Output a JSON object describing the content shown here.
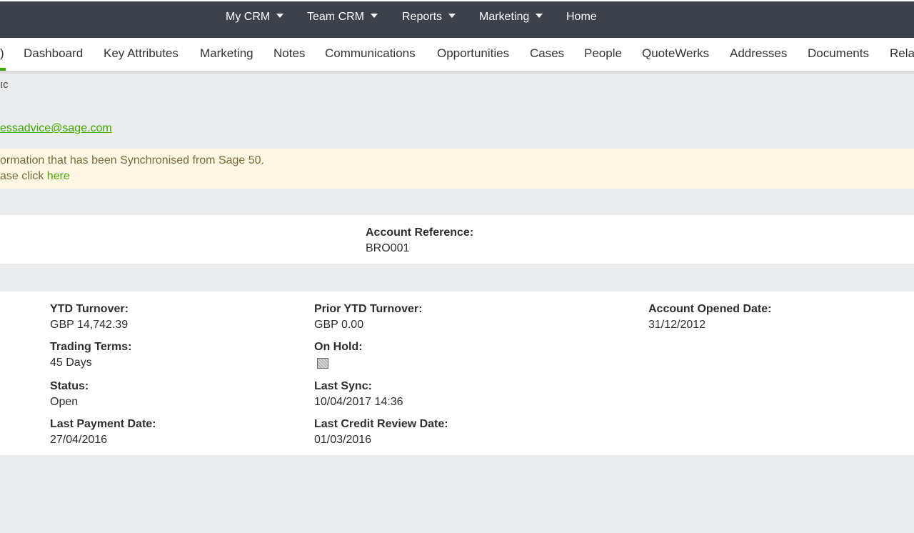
{
  "topnav": {
    "items": [
      {
        "label": "My CRM",
        "dropdown": true
      },
      {
        "label": "Team CRM",
        "dropdown": true
      },
      {
        "label": "Reports",
        "dropdown": true
      },
      {
        "label": "Marketing",
        "dropdown": true
      },
      {
        "label": "Home",
        "dropdown": false
      }
    ]
  },
  "tabs": {
    "items": [
      ")",
      "Dashboard",
      "Key Attributes",
      "Marketing",
      "Notes",
      "Communications",
      "Opportunities",
      "Cases",
      "People",
      "QuoteWerks",
      "Addresses",
      "Documents",
      "Rela"
    ],
    "active_index": 0,
    "accent_color": "#41a800"
  },
  "company": {
    "name_fragment": "ıc",
    "email": "essadvice@sage.com"
  },
  "notice": {
    "line1": "ormation that has been Synchronised from Sage 50.",
    "line2_prefix": "ase click ",
    "line2_link": "here"
  },
  "account": {
    "reference_label": "Account Reference:",
    "reference_value": "BRO001"
  },
  "details": {
    "ytd_turnover_label": "YTD Turnover:",
    "ytd_turnover_value": "GBP 14,742.39",
    "prior_ytd_label": "Prior YTD Turnover:",
    "prior_ytd_value": "GBP 0.00",
    "opened_label": "Account Opened Date:",
    "opened_value": "31/12/2012",
    "terms_label": "Trading Terms:",
    "terms_value": "45 Days",
    "on_hold_label": "On Hold:",
    "on_hold_checked": false,
    "status_label": "Status:",
    "status_value": "Open",
    "last_sync_label": "Last Sync:",
    "last_sync_value": "10/04/2017 14:36",
    "last_payment_label": "Last Payment Date:",
    "last_payment_value": "27/04/2016",
    "last_credit_label": "Last Credit Review Date:",
    "last_credit_value": "01/03/2016"
  }
}
